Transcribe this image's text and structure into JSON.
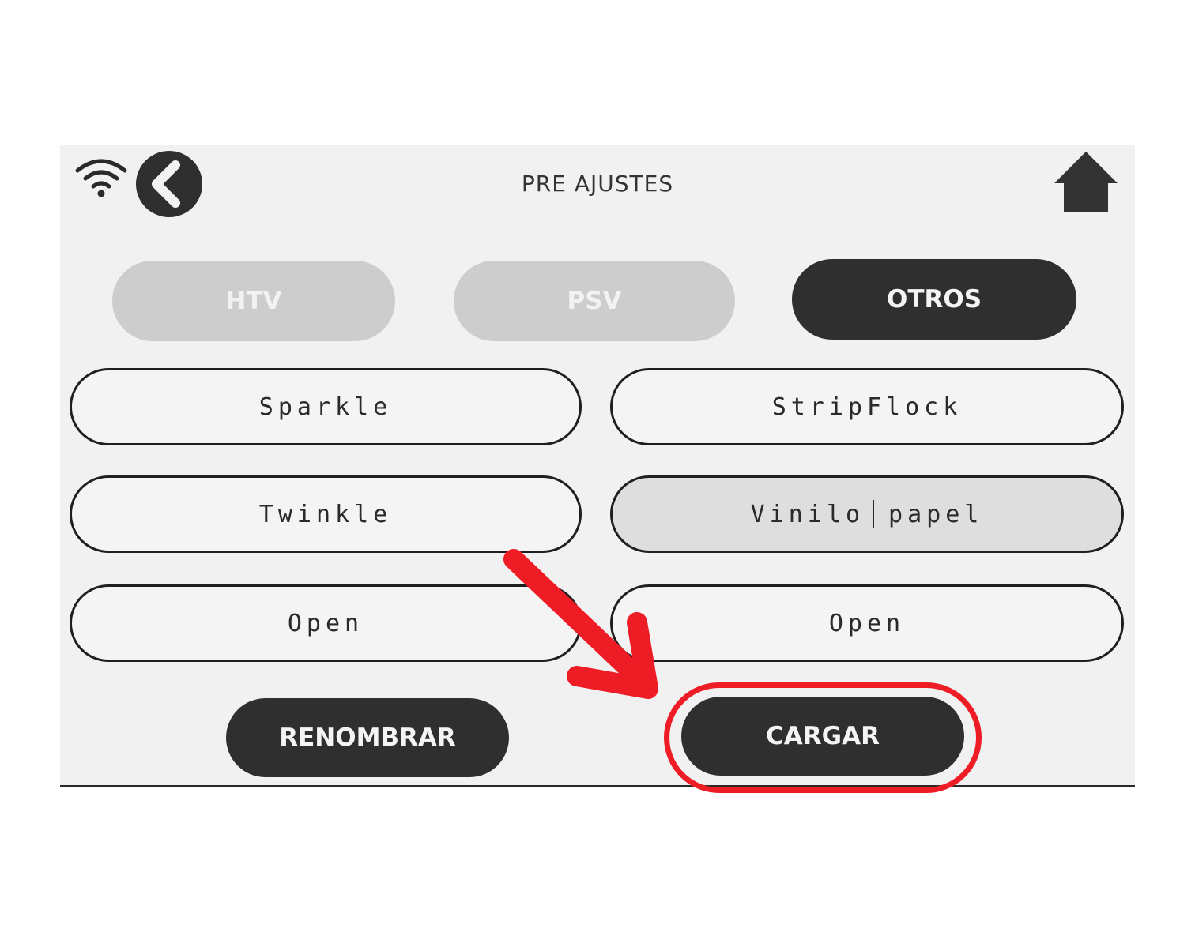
{
  "header": {
    "title": "PRE AJUSTES",
    "wifi_icon": "wifi-icon",
    "back_icon": "chevron-left-icon",
    "home_icon": "home-icon"
  },
  "tabs": [
    {
      "label": "HTV",
      "state": "inactive"
    },
    {
      "label": "PSV",
      "state": "inactive"
    },
    {
      "label": "OTROS",
      "state": "active"
    }
  ],
  "presets": {
    "left": [
      "Sparkle",
      "Twinkle",
      "Open"
    ],
    "right": {
      "row1": "StripFlock",
      "row2_part1": "Vinilo",
      "row2_part2": "papel",
      "row3": "Open"
    },
    "selected": "Vinilo | papel"
  },
  "actions": {
    "rename_label": "RENOMBRAR",
    "load_label": "CARGAR"
  },
  "annotation": {
    "color": "#ee1c24",
    "arrow_icon": "red-arrow-icon",
    "highlight_target": "CARGAR"
  },
  "colors": {
    "active": "#2f2f2f",
    "inactive": "#cdcdcd",
    "screen_bg": "#f1f1f1"
  }
}
